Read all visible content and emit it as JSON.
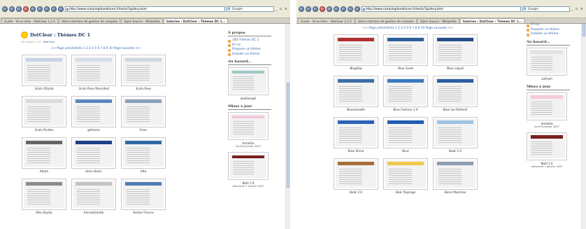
{
  "browser": {
    "url": "http://www.campingdandelune.fr/tests/?gallery.dsm",
    "search": "Google",
    "window_controls": "_ ▫ ×",
    "tabs": [
      "Guide - Virus Infos - DotClear 1.2.5",
      "Votre interface de gestion de comptes",
      "Open Source - Wikipédia",
      "Galeries : DotClear : Thèmes DC 1..."
    ]
  },
  "left": {
    "title": "DotClear : Thèmes DC 1",
    "byline": "Par Gallery 3.6 :",
    "byline_link": "DotClear",
    "pager": "<< Page précédente 1 2 3 4 5 6 7 8 9 10 Page suivante >>",
    "thumbs": [
      {
        "caption": "3cols-1fluide",
        "header": "#c7d3e4"
      },
      {
        "caption": "3cols-fixes Revisited",
        "header": "#d5dce8"
      },
      {
        "caption": "3cols-fixes",
        "header": "#cfd6e0"
      },
      {
        "caption": "3cols-fluides",
        "header": "#d9d9d9"
      },
      {
        "caption": "@theme",
        "header": "#5a86bd"
      },
      {
        "caption": "Acier",
        "header": "#8aa1ba"
      },
      {
        "caption": "Adam",
        "header": "#666666"
      },
      {
        "caption": "Aero-Glass",
        "header": "#1d3f86"
      },
      {
        "caption": "Alta",
        "header": "#2e6aa8"
      },
      {
        "caption": "Alto Studio",
        "header": "#8a8a8a"
      },
      {
        "caption": "Animaltamtik",
        "header": "#c3c3c3"
      },
      {
        "caption": "Anime France",
        "header": "#4f7fb3"
      }
    ],
    "side": {
      "apropos_title": "À propos",
      "apropos_items": [
        "180 Thèmes DC 1",
        "Fil rss",
        "Proposer un thème",
        "Installer un thème"
      ],
      "hasard_title": "Au hasard...",
      "hasard_caption": "web2angel",
      "maj_title": "Mises à jour",
      "maj_items": [
        {
          "caption": "Aarakita",
          "date": "lundi 8 janvier 2007"
        },
        {
          "caption": "Noël 1.0",
          "date": "dimanche 7 janvier 2007"
        }
      ]
    }
  },
  "right": {
    "pager": "<< Page précédente 1 2 3 4 5 6 7 8 9 10 Page suivante >>",
    "thumbs": [
      {
        "caption": "BlogSlip",
        "header": "#b03030"
      },
      {
        "caption": "Blue Geek",
        "header": "#2f5f9a"
      },
      {
        "caption": "Blue Liquid",
        "header": "#254e88"
      },
      {
        "caption": "Bluesmooth",
        "header": "#3c6ea8"
      },
      {
        "caption": "Blue Fashion 1.0",
        "header": "#3a78c2"
      },
      {
        "caption": "Blue Ice Refresh",
        "header": "#2c5e9f"
      },
      {
        "caption": "Blue Shine",
        "header": "#2a63b8"
      },
      {
        "caption": "Blue",
        "header": "#1f5db0"
      },
      {
        "caption": "Boat 1.0",
        "header": "#9ec2e3"
      },
      {
        "caption": "Boat 2.0",
        "header": "#a86e3a"
      },
      {
        "caption": "Bob l'Eponge",
        "header": "#f2c84b"
      },
      {
        "caption": "Bone Machine",
        "header": "#8e9db0"
      }
    ],
    "side": {
      "apropos_items": [
        "Fil rss",
        "Proposer un thème",
        "Installer un thème"
      ],
      "hasard_title": "Au hasard...",
      "hasard_caption": "soFresh",
      "maj_title": "Mises à jour",
      "maj_items": [
        {
          "caption": "Aarakita",
          "date": "lundi 8 janvier 2007"
        },
        {
          "caption": "Noël 1.0",
          "date": "dimanche 7 janvier 2007"
        }
      ]
    }
  },
  "colors": {
    "accent": "#1a3366",
    "link": "#3366aa",
    "chrome": "#ece9d8"
  }
}
